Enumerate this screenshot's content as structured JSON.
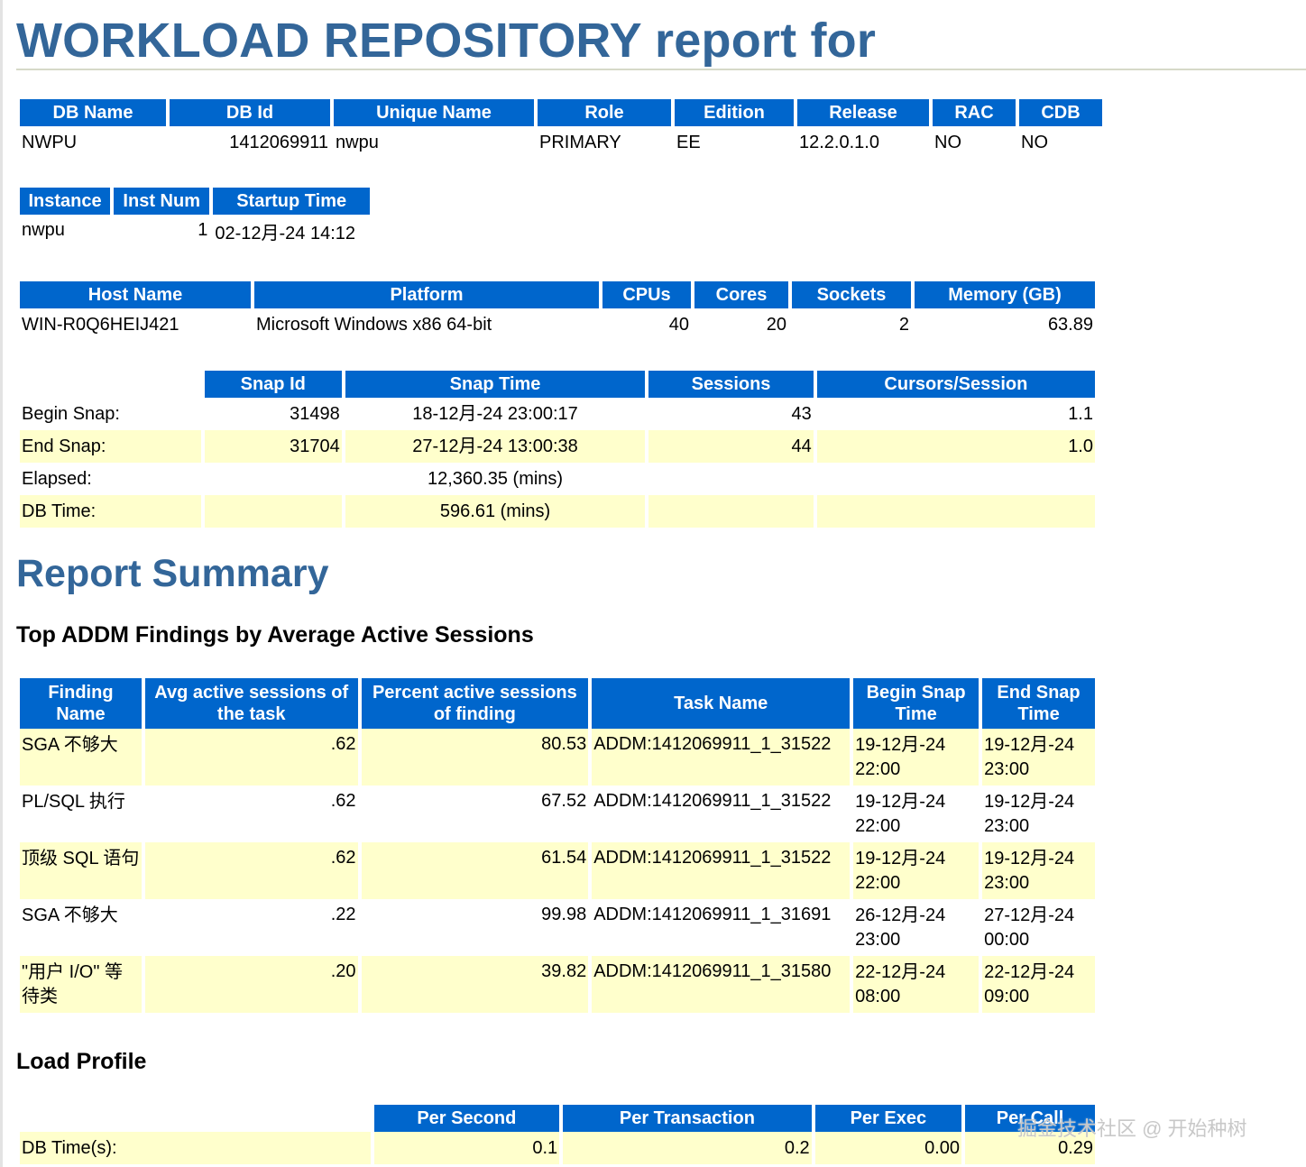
{
  "title": "WORKLOAD REPOSITORY report for",
  "db_table": {
    "headers": [
      "DB Name",
      "DB Id",
      "Unique Name",
      "Role",
      "Edition",
      "Release",
      "RAC",
      "CDB"
    ],
    "row": [
      "NWPU",
      "1412069911",
      "nwpu",
      "PRIMARY",
      "EE",
      "12.2.0.1.0",
      "NO",
      "NO"
    ]
  },
  "instance_table": {
    "headers": [
      "Instance",
      "Inst Num",
      "Startup Time"
    ],
    "row": [
      "nwpu",
      "1",
      "02-12月-24 14:12"
    ]
  },
  "host_table": {
    "headers": [
      "Host Name",
      "Platform",
      "CPUs",
      "Cores",
      "Sockets",
      "Memory (GB)"
    ],
    "row": [
      "WIN-R0Q6HEIJ421",
      "Microsoft Windows x86 64-bit",
      "40",
      "20",
      "2",
      "63.89"
    ]
  },
  "snap_table": {
    "headers": [
      "",
      "Snap Id",
      "Snap Time",
      "Sessions",
      "Cursors/Session"
    ],
    "rows": [
      [
        "Begin Snap:",
        "31498",
        "18-12月-24 23:00:17",
        "43",
        "1.1"
      ],
      [
        "End Snap:",
        "31704",
        "27-12月-24 13:00:38",
        "44",
        "1.0"
      ],
      [
        "Elapsed:",
        "",
        "12,360.35 (mins)",
        "",
        ""
      ],
      [
        "DB Time:",
        "",
        "596.61 (mins)",
        "",
        ""
      ]
    ]
  },
  "report_summary": {
    "title": "Report Summary",
    "addm_title": "Top ADDM Findings by Average Active Sessions",
    "addm_headers": [
      "Finding Name",
      "Avg active sessions of the task",
      "Percent active sessions of finding",
      "Task Name",
      "Begin Snap Time",
      "End Snap Time"
    ],
    "addm_rows": [
      [
        "SGA 不够大",
        ".62",
        "80.53",
        "ADDM:1412069911_1_31522",
        "19-12月-24 22:00",
        "19-12月-24 23:00"
      ],
      [
        "PL/SQL 执行",
        ".62",
        "67.52",
        "ADDM:1412069911_1_31522",
        "19-12月-24 22:00",
        "19-12月-24 23:00"
      ],
      [
        "顶级 SQL 语句",
        ".62",
        "61.54",
        "ADDM:1412069911_1_31522",
        "19-12月-24 22:00",
        "19-12月-24 23:00"
      ],
      [
        "SGA 不够大",
        ".22",
        "99.98",
        "ADDM:1412069911_1_31691",
        "26-12月-24 23:00",
        "27-12月-24 00:00"
      ],
      [
        "\"用户 I/O\" 等待类",
        ".20",
        "39.82",
        "ADDM:1412069911_1_31580",
        "22-12月-24 08:00",
        "22-12月-24 09:00"
      ]
    ],
    "load_title": "Load Profile",
    "load_headers": [
      "",
      "Per Second",
      "Per Transaction",
      "Per Exec",
      "Per Call"
    ],
    "load_rows": [
      [
        "DB Time(s):",
        "0.1",
        "0.2",
        "0.00",
        "0.29"
      ]
    ]
  },
  "watermark": "掘金技术社区 @ 开始种树",
  "colors": {
    "heading": "#336699",
    "header_bg": "#0066cc",
    "alt_row_bg": "#ffffcc"
  }
}
